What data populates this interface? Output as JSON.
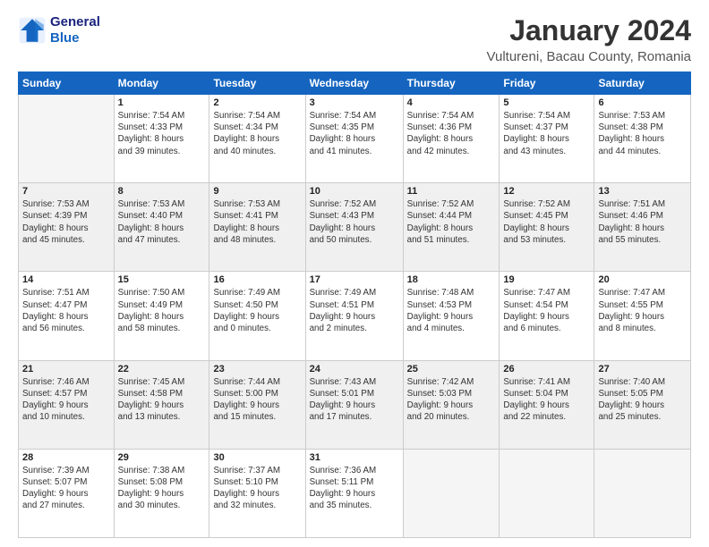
{
  "header": {
    "logo_line1": "General",
    "logo_line2": "Blue",
    "title": "January 2024",
    "subtitle": "Vultureni, Bacau County, Romania"
  },
  "weekdays": [
    "Sunday",
    "Monday",
    "Tuesday",
    "Wednesday",
    "Thursday",
    "Friday",
    "Saturday"
  ],
  "weeks": [
    [
      {
        "day": "",
        "info": ""
      },
      {
        "day": "1",
        "info": "Sunrise: 7:54 AM\nSunset: 4:33 PM\nDaylight: 8 hours\nand 39 minutes."
      },
      {
        "day": "2",
        "info": "Sunrise: 7:54 AM\nSunset: 4:34 PM\nDaylight: 8 hours\nand 40 minutes."
      },
      {
        "day": "3",
        "info": "Sunrise: 7:54 AM\nSunset: 4:35 PM\nDaylight: 8 hours\nand 41 minutes."
      },
      {
        "day": "4",
        "info": "Sunrise: 7:54 AM\nSunset: 4:36 PM\nDaylight: 8 hours\nand 42 minutes."
      },
      {
        "day": "5",
        "info": "Sunrise: 7:54 AM\nSunset: 4:37 PM\nDaylight: 8 hours\nand 43 minutes."
      },
      {
        "day": "6",
        "info": "Sunrise: 7:53 AM\nSunset: 4:38 PM\nDaylight: 8 hours\nand 44 minutes."
      }
    ],
    [
      {
        "day": "7",
        "info": "Sunrise: 7:53 AM\nSunset: 4:39 PM\nDaylight: 8 hours\nand 45 minutes."
      },
      {
        "day": "8",
        "info": "Sunrise: 7:53 AM\nSunset: 4:40 PM\nDaylight: 8 hours\nand 47 minutes."
      },
      {
        "day": "9",
        "info": "Sunrise: 7:53 AM\nSunset: 4:41 PM\nDaylight: 8 hours\nand 48 minutes."
      },
      {
        "day": "10",
        "info": "Sunrise: 7:52 AM\nSunset: 4:43 PM\nDaylight: 8 hours\nand 50 minutes."
      },
      {
        "day": "11",
        "info": "Sunrise: 7:52 AM\nSunset: 4:44 PM\nDaylight: 8 hours\nand 51 minutes."
      },
      {
        "day": "12",
        "info": "Sunrise: 7:52 AM\nSunset: 4:45 PM\nDaylight: 8 hours\nand 53 minutes."
      },
      {
        "day": "13",
        "info": "Sunrise: 7:51 AM\nSunset: 4:46 PM\nDaylight: 8 hours\nand 55 minutes."
      }
    ],
    [
      {
        "day": "14",
        "info": "Sunrise: 7:51 AM\nSunset: 4:47 PM\nDaylight: 8 hours\nand 56 minutes."
      },
      {
        "day": "15",
        "info": "Sunrise: 7:50 AM\nSunset: 4:49 PM\nDaylight: 8 hours\nand 58 minutes."
      },
      {
        "day": "16",
        "info": "Sunrise: 7:49 AM\nSunset: 4:50 PM\nDaylight: 9 hours\nand 0 minutes."
      },
      {
        "day": "17",
        "info": "Sunrise: 7:49 AM\nSunset: 4:51 PM\nDaylight: 9 hours\nand 2 minutes."
      },
      {
        "day": "18",
        "info": "Sunrise: 7:48 AM\nSunset: 4:53 PM\nDaylight: 9 hours\nand 4 minutes."
      },
      {
        "day": "19",
        "info": "Sunrise: 7:47 AM\nSunset: 4:54 PM\nDaylight: 9 hours\nand 6 minutes."
      },
      {
        "day": "20",
        "info": "Sunrise: 7:47 AM\nSunset: 4:55 PM\nDaylight: 9 hours\nand 8 minutes."
      }
    ],
    [
      {
        "day": "21",
        "info": "Sunrise: 7:46 AM\nSunset: 4:57 PM\nDaylight: 9 hours\nand 10 minutes."
      },
      {
        "day": "22",
        "info": "Sunrise: 7:45 AM\nSunset: 4:58 PM\nDaylight: 9 hours\nand 13 minutes."
      },
      {
        "day": "23",
        "info": "Sunrise: 7:44 AM\nSunset: 5:00 PM\nDaylight: 9 hours\nand 15 minutes."
      },
      {
        "day": "24",
        "info": "Sunrise: 7:43 AM\nSunset: 5:01 PM\nDaylight: 9 hours\nand 17 minutes."
      },
      {
        "day": "25",
        "info": "Sunrise: 7:42 AM\nSunset: 5:03 PM\nDaylight: 9 hours\nand 20 minutes."
      },
      {
        "day": "26",
        "info": "Sunrise: 7:41 AM\nSunset: 5:04 PM\nDaylight: 9 hours\nand 22 minutes."
      },
      {
        "day": "27",
        "info": "Sunrise: 7:40 AM\nSunset: 5:05 PM\nDaylight: 9 hours\nand 25 minutes."
      }
    ],
    [
      {
        "day": "28",
        "info": "Sunrise: 7:39 AM\nSunset: 5:07 PM\nDaylight: 9 hours\nand 27 minutes."
      },
      {
        "day": "29",
        "info": "Sunrise: 7:38 AM\nSunset: 5:08 PM\nDaylight: 9 hours\nand 30 minutes."
      },
      {
        "day": "30",
        "info": "Sunrise: 7:37 AM\nSunset: 5:10 PM\nDaylight: 9 hours\nand 32 minutes."
      },
      {
        "day": "31",
        "info": "Sunrise: 7:36 AM\nSunset: 5:11 PM\nDaylight: 9 hours\nand 35 minutes."
      },
      {
        "day": "",
        "info": ""
      },
      {
        "day": "",
        "info": ""
      },
      {
        "day": "",
        "info": ""
      }
    ]
  ]
}
